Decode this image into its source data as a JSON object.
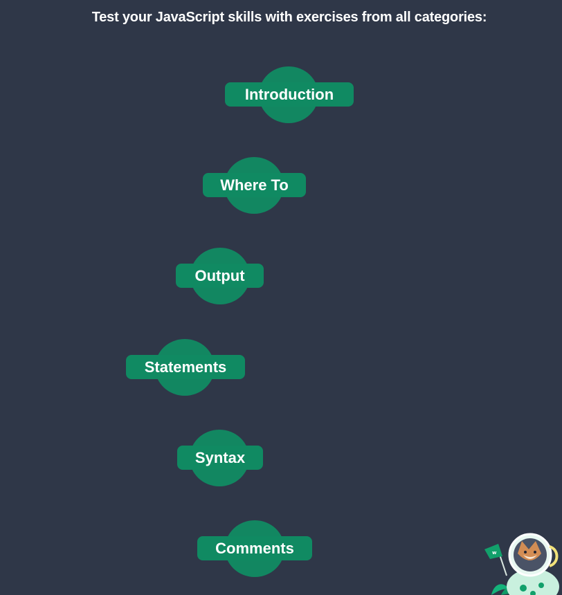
{
  "heading": "Test your JavaScript skills with exercises from all categories:",
  "categories": [
    {
      "label": "Introduction"
    },
    {
      "label": "Where To"
    },
    {
      "label": "Output"
    },
    {
      "label": "Statements"
    },
    {
      "label": "Syntax"
    },
    {
      "label": "Comments"
    }
  ],
  "colors": {
    "background": "#2f3748",
    "node_green": "#128761",
    "text": "#ffffff"
  },
  "mascot": {
    "icon": "astronaut-fox-mascot-icon"
  }
}
